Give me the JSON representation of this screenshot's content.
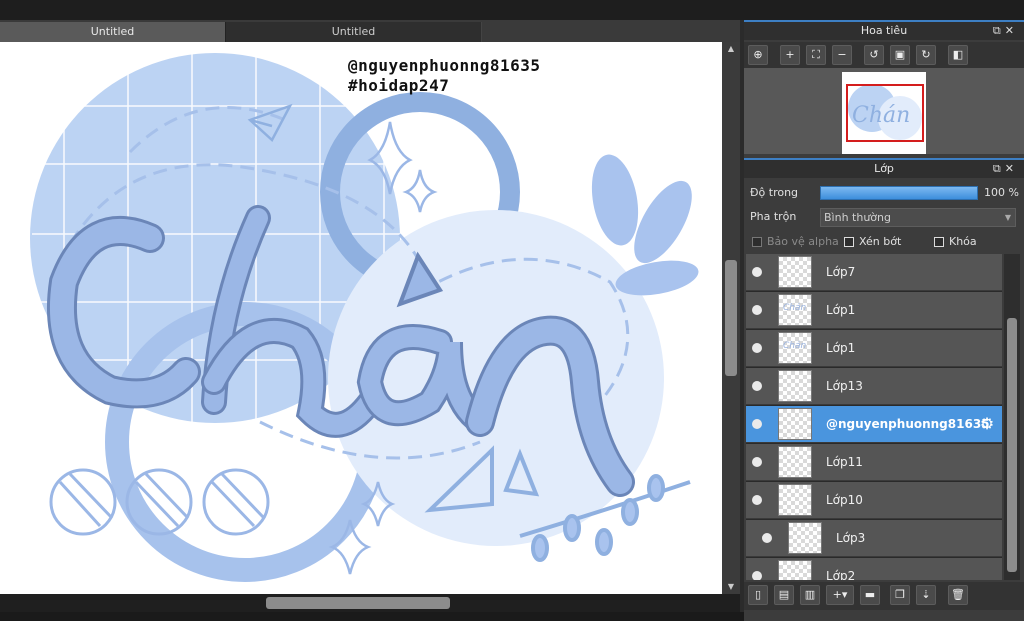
{
  "document_tabs": [
    {
      "label": "Untitled",
      "active": true
    },
    {
      "label": "Untitled",
      "active": false
    }
  ],
  "canvas": {
    "watermark_line1": "@nguyenphuonng81635",
    "watermark_line2": "#hoidap247",
    "artwork_text": "Chán",
    "colors": {
      "light_blue": "#bcd3f3",
      "mid_blue": "#8fb0e0",
      "pale_blue": "#e2ecfb",
      "outline": "#6b86b8"
    }
  },
  "navigator": {
    "title": "Hoa tiêu",
    "tools": [
      "zoom-fit-icon",
      "zoom-in-icon",
      "fit-screen-icon",
      "zoom-out-icon",
      "rotate-left-icon",
      "actual-size-icon",
      "rotate-right-icon",
      "flip-icon"
    ],
    "thumbnail_text": "Chán"
  },
  "layers_panel": {
    "title": "Lớp",
    "opacity_label": "Độ trong",
    "opacity_value": "100 %",
    "opacity_fraction": 1.0,
    "blend_label": "Pha trộn",
    "blend_value": "Bình thường",
    "protect_alpha_label": "Bảo vệ alpha",
    "clipping_label": "Xén bớt",
    "lock_label": "Khóa",
    "items": [
      {
        "name": "Lớp7",
        "selected": false,
        "indent": false,
        "thumb_text": ""
      },
      {
        "name": "Lớp1",
        "selected": false,
        "indent": false,
        "thumb_text": "Chán"
      },
      {
        "name": "Lớp1",
        "selected": false,
        "indent": false,
        "thumb_text": "Chán"
      },
      {
        "name": "Lớp13",
        "selected": false,
        "indent": false,
        "thumb_text": ""
      },
      {
        "name": "@nguyenphuonng81635",
        "selected": true,
        "indent": false,
        "thumb_text": ""
      },
      {
        "name": "Lớp11",
        "selected": false,
        "indent": false,
        "thumb_text": ""
      },
      {
        "name": "Lớp10",
        "selected": false,
        "indent": false,
        "thumb_text": ""
      },
      {
        "name": "Lớp3",
        "selected": false,
        "indent": true,
        "thumb_text": ""
      },
      {
        "name": "Lớp2",
        "selected": false,
        "indent": false,
        "thumb_text": ""
      }
    ],
    "tools": [
      "new-layer-icon",
      "new-layer-copy-icon",
      "layer-settings-icon",
      "add-layer-menu-icon",
      "folder-icon",
      "duplicate-icon",
      "merge-icon",
      "delete-layer-icon"
    ]
  },
  "accent_color": "#4a95de"
}
